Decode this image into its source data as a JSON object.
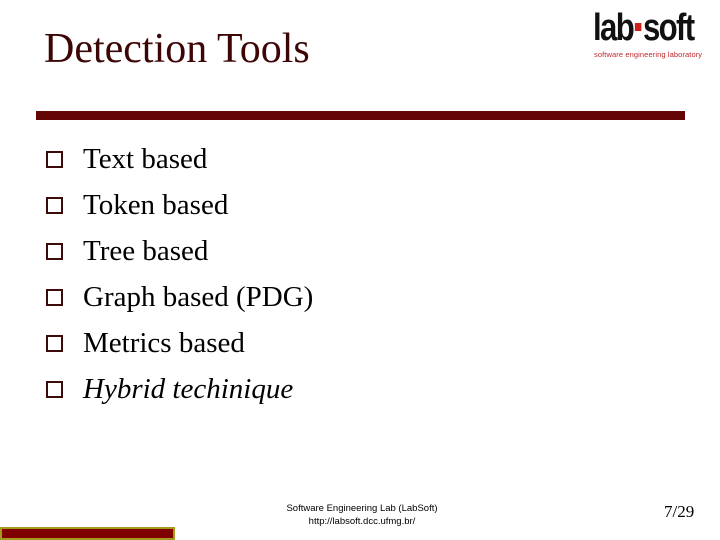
{
  "slide": {
    "title": "Detection Tools",
    "logo": {
      "main_left": "lab",
      "main_right": "soft",
      "tagline": "software engineering laboratory",
      "accent_color": "#d0201c"
    },
    "bullets": [
      {
        "text": "Text based",
        "italic": false
      },
      {
        "text": "Token based",
        "italic": false
      },
      {
        "text": "Tree based",
        "italic": false
      },
      {
        "text": "Graph based (PDG)",
        "italic": false
      },
      {
        "text": "Metrics based",
        "italic": false
      },
      {
        "text": "Hybrid techinique",
        "italic": true
      }
    ],
    "footer": {
      "line1": "Software Engineering Lab (LabSoft)",
      "line2": "http://labsoft.dcc.ufmg.br/",
      "page": "7/29"
    },
    "colors": {
      "title": "#3d0606",
      "rule": "#650606",
      "bar_fill": "#800000",
      "bar_border": "#a39a1e"
    }
  }
}
